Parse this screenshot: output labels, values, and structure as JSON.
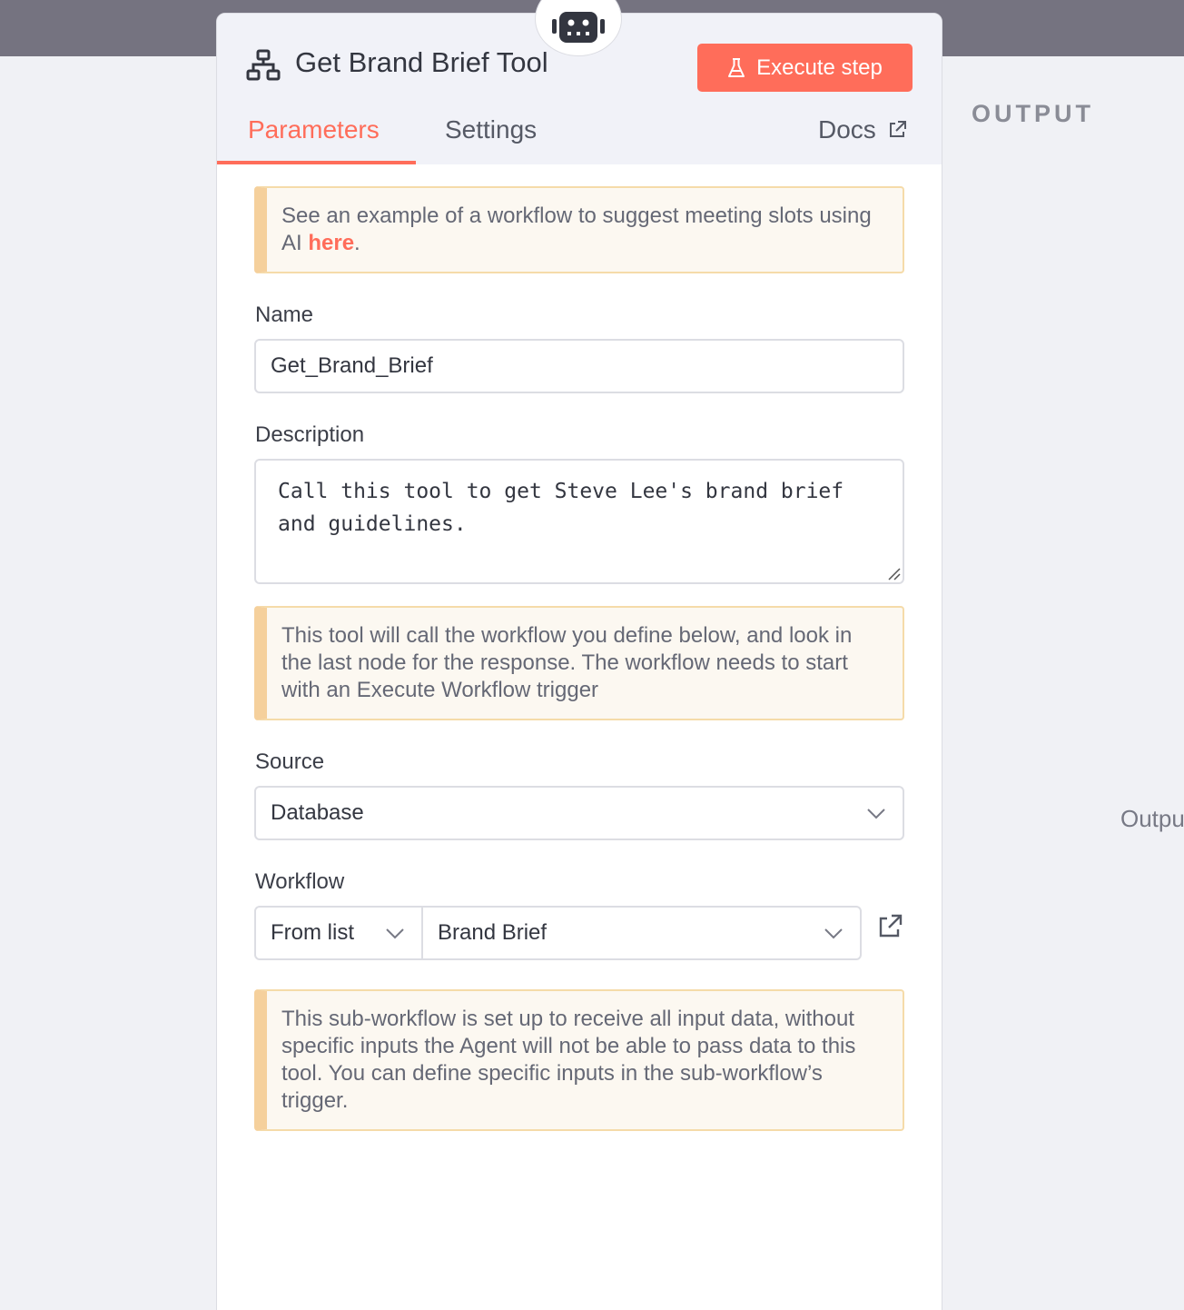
{
  "node": {
    "title": "Get Brand Brief Tool",
    "execute_label": "Execute step"
  },
  "tabs": {
    "parameters": "Parameters",
    "settings": "Settings",
    "docs": "Docs"
  },
  "notices": {
    "example_before": "See an example of a workflow to suggest meeting slots using AI ",
    "example_link": "here",
    "example_after": ".",
    "tool_info": "This tool will call the workflow you define below, and look in the last node for the response. The workflow needs to start with an Execute Workflow trigger",
    "subworkflow_info": "This sub-workflow is set up to receive all input data, without specific inputs the Agent will not be able to pass data to this tool. You can define specific inputs in the sub-workflow’s trigger."
  },
  "fields": {
    "name_label": "Name",
    "name_value": "Get_Brand_Brief",
    "description_label": "Description",
    "description_value": "Call this tool to get Steve Lee's brand brief and guidelines.",
    "source_label": "Source",
    "source_value": "Database",
    "workflow_label": "Workflow",
    "workflow_mode": "From list",
    "workflow_value": "Brand Brief"
  },
  "output_panel": {
    "title": "OUTPUT",
    "side_text": "Outpu"
  },
  "colors": {
    "accent": "#ff6d5a",
    "notice_bg": "#fcf8f1",
    "notice_border": "#f5d09c"
  }
}
